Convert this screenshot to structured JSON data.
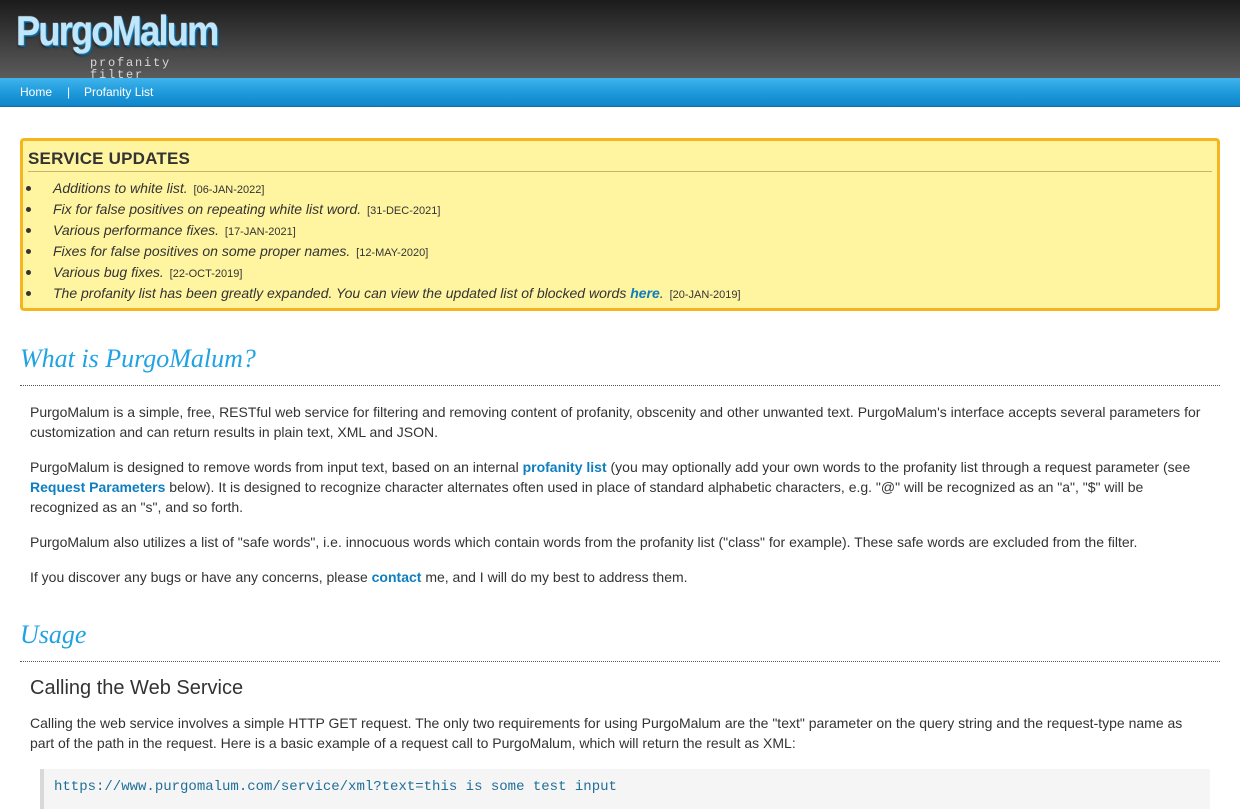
{
  "header": {
    "logo_main": "PurgoMalum",
    "logo_sub": "profanity filter"
  },
  "nav": {
    "items": [
      {
        "label": "Home"
      },
      {
        "label": "Profanity List"
      }
    ],
    "separator": "|"
  },
  "updates": {
    "title": "SERVICE UPDATES",
    "items": [
      {
        "text": "Additions to white list.",
        "date": "[06-JAN-2022]"
      },
      {
        "text": "Fix for false positives on repeating white list word.",
        "date": "[31-DEC-2021]"
      },
      {
        "text": "Various performance fixes.",
        "date": "[17-JAN-2021]"
      },
      {
        "text": "Fixes for false positives on some proper names.",
        "date": "[12-MAY-2020]"
      },
      {
        "text": "Various bug fixes.",
        "date": "[22-OCT-2019]"
      },
      {
        "text": "The profanity list has been greatly expanded. You can view the updated list of blocked words",
        "link": "here",
        "after": ".",
        "date": "[20-JAN-2019]"
      }
    ]
  },
  "what": {
    "heading": "What is PurgoMalum?",
    "p1": "PurgoMalum is a simple, free, RESTful web service for filtering and removing content of profanity, obscenity and other unwanted text. PurgoMalum's interface accepts several parameters for customization and can return results in plain text, XML and JSON.",
    "p2_a": "PurgoMalum is designed to remove words from input text, based on an internal",
    "p2_link1": "profanity list",
    "p2_b": "(you may optionally add your own words to the profanity list through a request parameter (see",
    "p2_link2": "Request Parameters",
    "p2_c": "below). It is designed to recognize character alternates often used in place of standard alphabetic characters, e.g. \"@\" will be recognized as an \"a\", \"$\" will be recognized as an \"s\", and so forth.",
    "p3": "PurgoMalum also utilizes a list of \"safe words\", i.e. innocuous words which contain words from the profanity list (\"class\" for example). These safe words are excluded from the filter.",
    "p4_a": "If you discover any bugs or have any concerns, please",
    "p4_link": "contact",
    "p4_b": "me, and I will do my best to address them."
  },
  "usage": {
    "heading": "Usage",
    "subheading": "Calling the Web Service",
    "p1": "Calling the web service involves a simple HTTP GET request. The only two requirements for using PurgoMalum are the \"text\" parameter on the query string and the request-type name as part of the path in the request. Here is a basic example of a request call to PurgoMalum, which will return the result as XML:",
    "code": "https://www.purgomalum.com/service/xml?text=this is some test input"
  }
}
